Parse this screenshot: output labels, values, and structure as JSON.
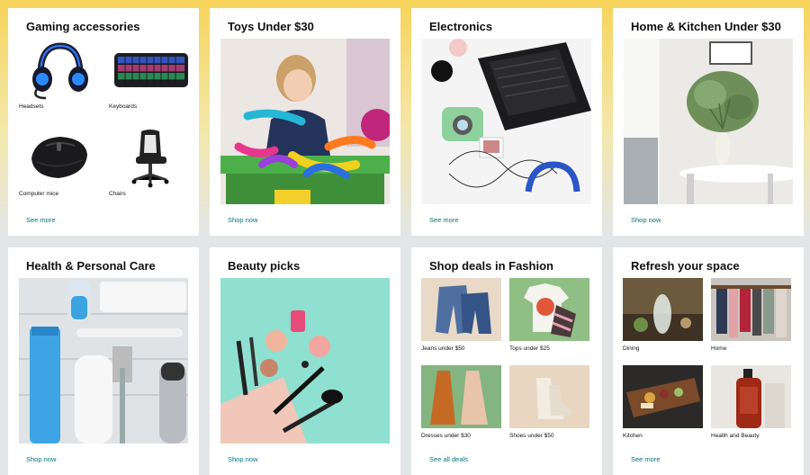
{
  "cards": [
    {
      "title": "Gaming accessories",
      "link": "See more",
      "items": [
        {
          "label": "Headsets",
          "icon": "headset-icon"
        },
        {
          "label": "Keyboards",
          "icon": "keyboard-icon"
        },
        {
          "label": "Computer mice",
          "icon": "mouse-icon"
        },
        {
          "label": "Chairs",
          "icon": "gaming-chair-icon"
        }
      ]
    },
    {
      "title": "Toys Under $30",
      "link": "Shop now"
    },
    {
      "title": "Electronics",
      "link": "See more"
    },
    {
      "title": "Home & Kitchen Under $30",
      "link": "Shop now"
    },
    {
      "title": "Health & Personal Care",
      "link": "Shop now"
    },
    {
      "title": "Beauty picks",
      "link": "Shop now"
    },
    {
      "title": "Shop deals in Fashion",
      "link": "See all deals",
      "items": [
        {
          "label": "Jeans under $50"
        },
        {
          "label": "Tops under $25"
        },
        {
          "label": "Dresses under $30"
        },
        {
          "label": "Shoes under $50"
        }
      ]
    },
    {
      "title": "Refresh your space",
      "link": "See more",
      "items": [
        {
          "label": "Dining"
        },
        {
          "label": "Home"
        },
        {
          "label": "Kitchen"
        },
        {
          "label": "Health and Beauty"
        }
      ]
    }
  ],
  "colors": {
    "link": "#007185",
    "title": "#0f1111",
    "background_top": "#f7d35a",
    "background": "#e3e6e6"
  }
}
